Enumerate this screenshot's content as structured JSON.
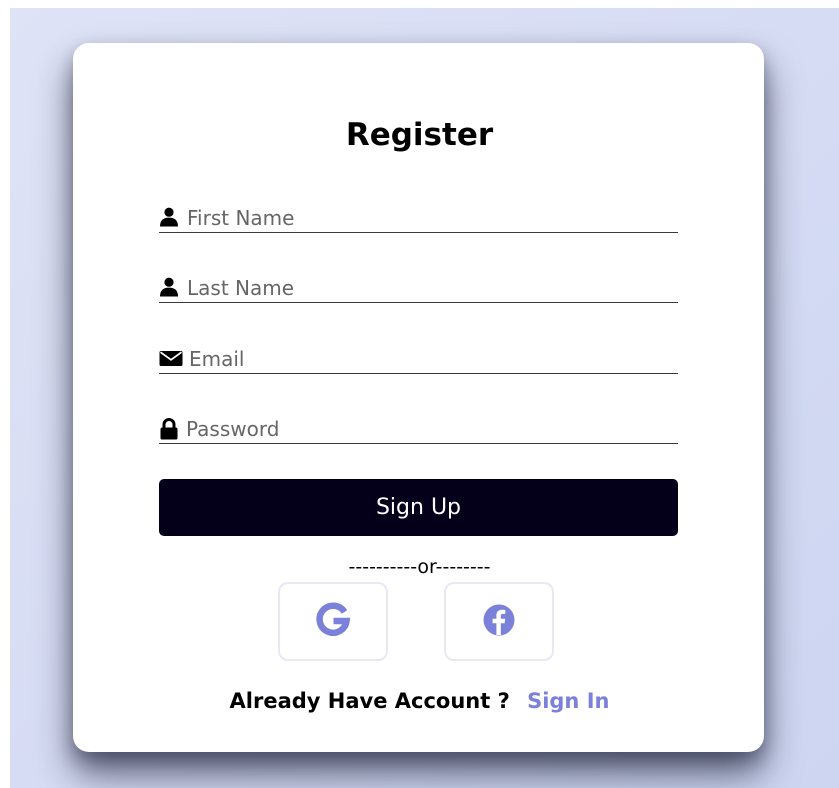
{
  "form": {
    "title": "Register",
    "fields": {
      "first_name": {
        "placeholder": "First Name",
        "value": "",
        "icon": "user-icon"
      },
      "last_name": {
        "placeholder": "Last Name",
        "value": "",
        "icon": "user-icon"
      },
      "email": {
        "placeholder": "Email",
        "value": "",
        "icon": "envelope-icon"
      },
      "password": {
        "placeholder": "Password",
        "value": "",
        "icon": "lock-icon"
      }
    },
    "submit_label": "Sign Up",
    "divider_text": "----------or--------",
    "social": {
      "google": {
        "icon": "google-icon",
        "color": "#7b81d9"
      },
      "facebook": {
        "icon": "facebook-icon",
        "color": "#7b81d9"
      }
    },
    "footer": {
      "question": "Already Have Account ?",
      "signin_label": "Sign In"
    }
  },
  "colors": {
    "accent": "#7b81d9",
    "button_bg": "#05001a",
    "page_bg": "#d4daf3"
  }
}
